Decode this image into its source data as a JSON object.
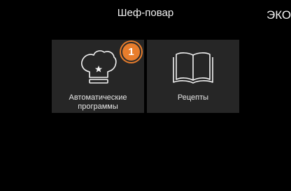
{
  "header": {
    "title": "Шеф-повар",
    "mode_label": "ЭКО"
  },
  "tiles": [
    {
      "id": "auto-programs",
      "label_line1": "Автоматические",
      "label_line2": "программы",
      "icon": "chef-hat-icon",
      "badge": "1"
    },
    {
      "id": "recipes",
      "label_line1": "Рецепты",
      "icon": "open-book-icon"
    }
  ],
  "colors": {
    "background": "#000000",
    "tile": "#262626",
    "accent": "#e87d2c",
    "text": "#f2f2f2"
  }
}
